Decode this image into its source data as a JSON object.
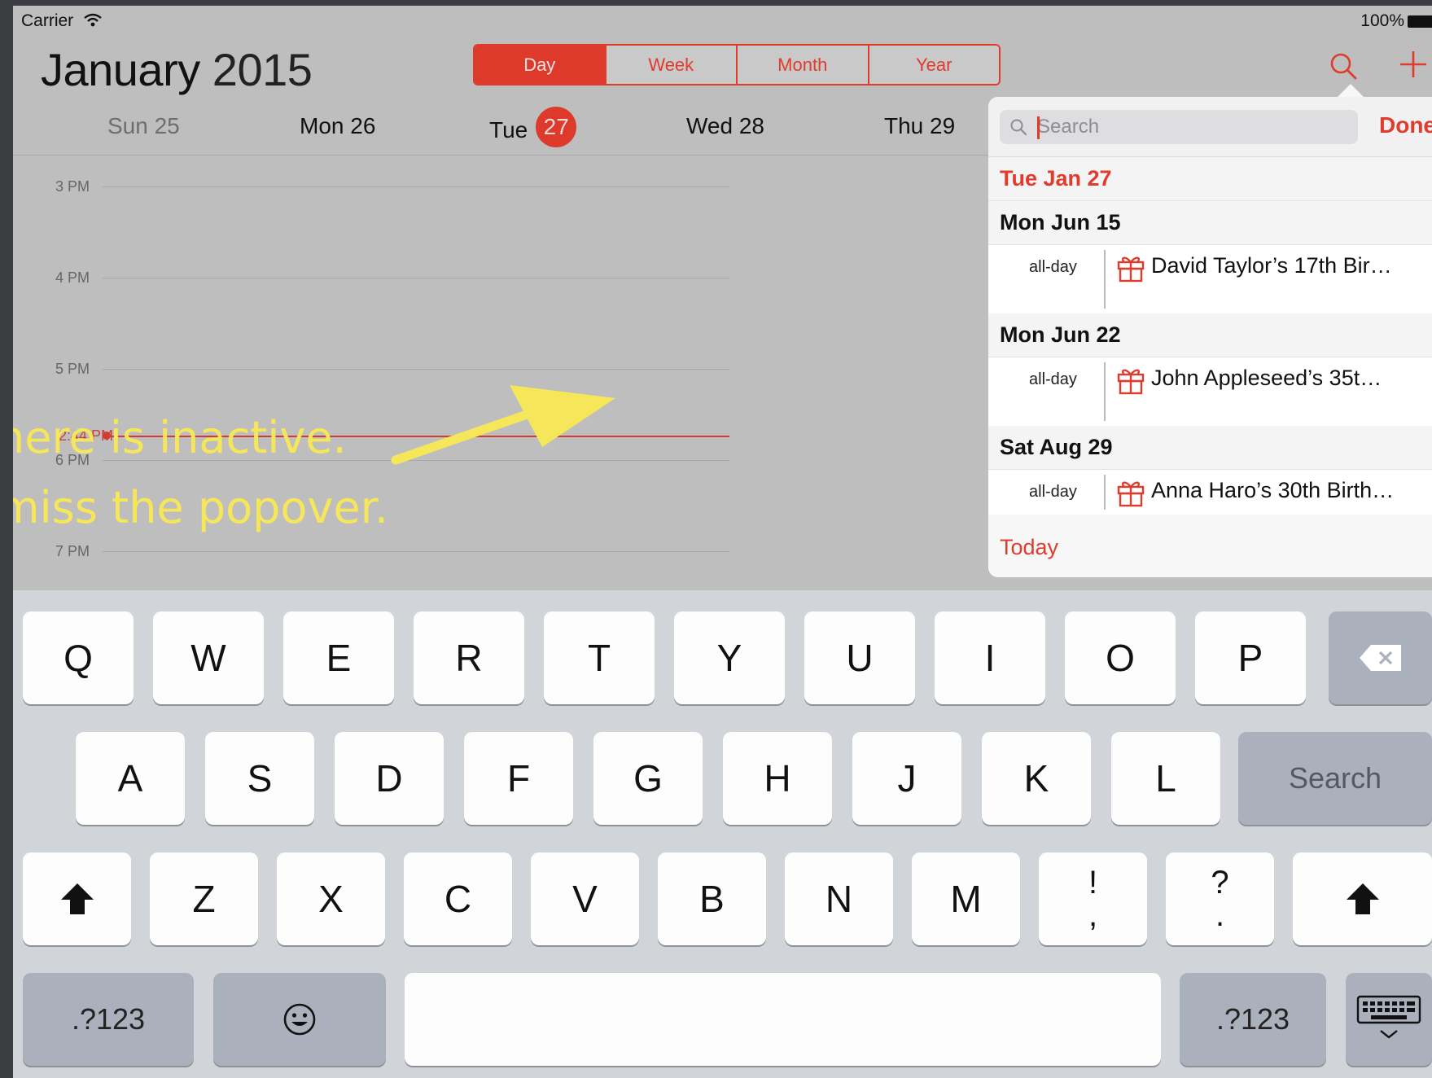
{
  "status": {
    "carrier": "Carrier",
    "battery": "100%"
  },
  "header": {
    "month": "January",
    "year": "2015"
  },
  "segments": [
    "Day",
    "Week",
    "Month",
    "Year"
  ],
  "days": [
    "Sun 25",
    "Mon 26",
    "Tue",
    "Wed 28",
    "Thu 29"
  ],
  "today_number": "27",
  "hours": [
    "3 PM",
    "4 PM",
    "5 PM",
    "6 PM",
    "7 PM"
  ],
  "now_label": "2:44 PM",
  "annotation": {
    "line1": "here is inactive.",
    "line2": "miss the popover."
  },
  "popover": {
    "search_placeholder": "Search",
    "done": "Done",
    "headers": [
      "Tue  Jan 27",
      "Mon  Jun 15",
      "Mon  Jun 22",
      "Sat  Aug 29"
    ],
    "events": [
      {
        "time": "all-day",
        "title": "David Taylor’s 17th Bir…"
      },
      {
        "time": "all-day",
        "title": "John Appleseed’s 35t…"
      },
      {
        "time": "all-day",
        "title": "Anna Haro’s 30th Birth…"
      }
    ],
    "today": "Today"
  },
  "keyboard": {
    "row1": [
      "Q",
      "W",
      "E",
      "R",
      "T",
      "Y",
      "U",
      "I",
      "O",
      "P"
    ],
    "row2": [
      "A",
      "S",
      "D",
      "F",
      "G",
      "H",
      "J",
      "K",
      "L"
    ],
    "row3": [
      "Z",
      "X",
      "C",
      "V",
      "B",
      "N",
      "M"
    ],
    "punct1": {
      "top": "!",
      "bottom": ","
    },
    "punct2": {
      "top": "?",
      "bottom": "."
    },
    "search_key": "Search",
    "numbers_key": ".?123"
  },
  "colors": {
    "accent": "#e03b2d",
    "annotation": "#f6e65a"
  }
}
